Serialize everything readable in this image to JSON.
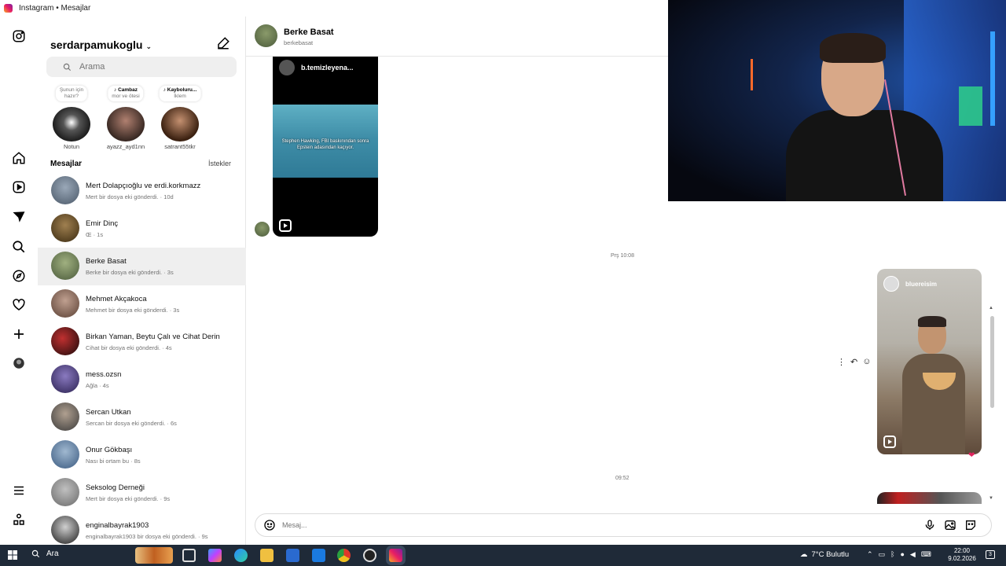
{
  "window": {
    "title": "Instagram • Mesajlar"
  },
  "sidebar": {
    "username": "serdarpamukoglu",
    "search_placeholder": "Arama",
    "notes": [
      {
        "line1": "Şunun için",
        "line2": "hazır?",
        "name": "Notun"
      },
      {
        "line1": "Cambaz",
        "line2": "mor ve ötesi",
        "name": "ayazz_ayd1nn"
      },
      {
        "line1": "Kayboluru...",
        "line2": "İklem",
        "name": "satrant55tkr"
      }
    ],
    "messages_header": "Mesajlar",
    "requests_label": "İstekler",
    "conversations": [
      {
        "name": "Mert Dolapçıoğlu ve erdi.korkmazz",
        "sub": "Mert bir dosya eki gönderdi. · 10d",
        "color": "#7a8aa0"
      },
      {
        "name": "Emir Dinç",
        "sub": "Œ · 1s",
        "color": "#6a5430"
      },
      {
        "name": "Berke Basat",
        "sub": "Berke bir dosya eki gönderdi. · 3s",
        "color": "#6f8a5a"
      },
      {
        "name": "Mehmet Akçakoca",
        "sub": "Mehmet bir dosya eki gönderdi. · 3s",
        "color": "#8a7060"
      },
      {
        "name": "Birkan Yaman, Beytu Çalı ve Cihat Derin",
        "sub": "Cihat bir dosya eki gönderdi. · 4s",
        "color": "#3a2020"
      },
      {
        "name": "mess.ozsn",
        "sub": "Ağla · 4s",
        "color": "#5a4a8a"
      },
      {
        "name": "Sercan Utkan",
        "sub": "Sercan bir dosya eki gönderdi. · 6s",
        "color": "#6a6a6a"
      },
      {
        "name": "Onur Gökbaşı",
        "sub": "Nası bi ortam bu · 8s",
        "color": "#5a7aa0"
      },
      {
        "name": "Seksolog Derneği",
        "sub": "Mert bir dosya eki gönderdi. · 9s",
        "color": "#8a8a8a"
      },
      {
        "name": "enginalbayrak1903",
        "sub": "enginalbayrak1903 bir dosya eki gönderdi. · 9s",
        "color": "#2a2a2a"
      }
    ]
  },
  "chat": {
    "contact_name": "Berke Basat",
    "contact_user": "berkebasat",
    "reel1_author": "b.temizleyena...",
    "reel1_caption": "Stephen Hawking, FBI baskınından sonra Epstein adasından kaçıyor.",
    "timestamp1": "Prş 10:08",
    "reel2_author": "bluereisim",
    "timestamp2": "09:52",
    "composer_placeholder": "Mesaj..."
  },
  "taskbar": {
    "search_label": "Ara",
    "weather": "7°C  Bulutlu",
    "time": "22:00",
    "date": "9.02.2026",
    "notification_count": "3"
  }
}
